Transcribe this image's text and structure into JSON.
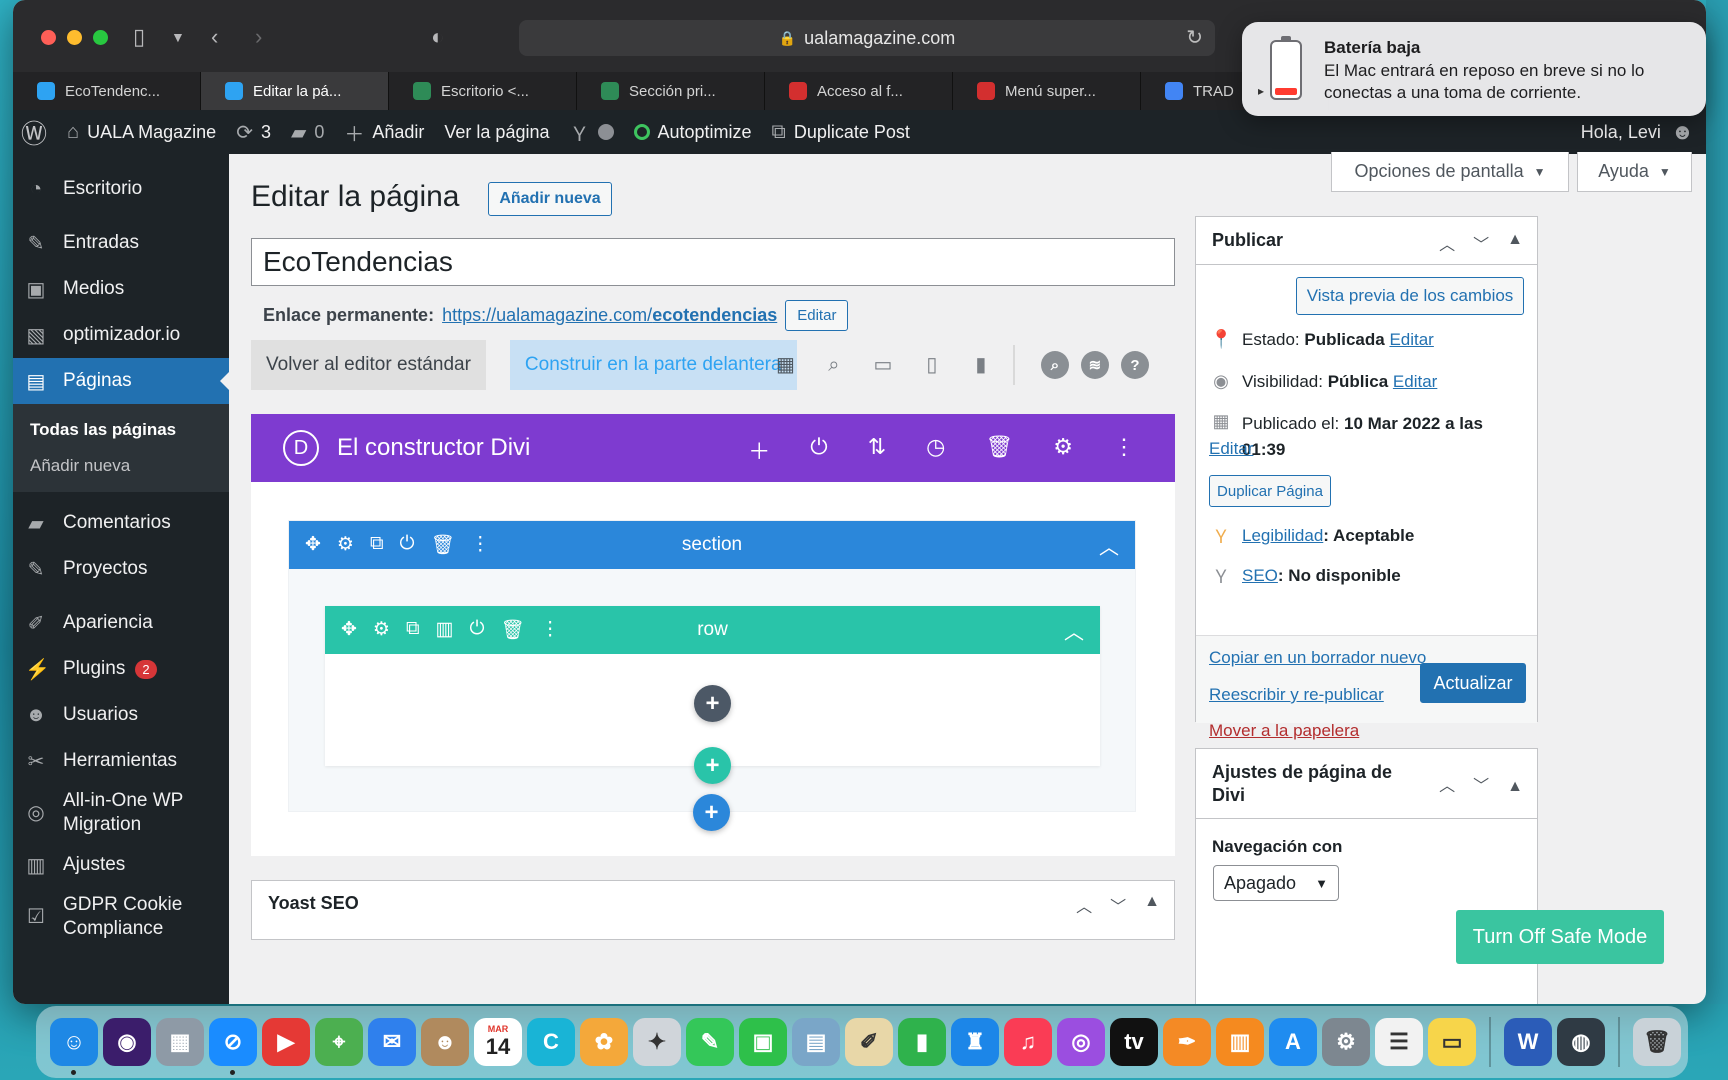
{
  "browser": {
    "url": "ualamagazine.com",
    "tabs": [
      {
        "label": "EcoTendenc...",
        "color": "#2ea3f2",
        "active": false
      },
      {
        "label": "Editar la pá...",
        "color": "#2ea3f2",
        "active": true
      },
      {
        "label": "Escritorio <...",
        "color": "#2e8b57",
        "active": false
      },
      {
        "label": "Sección pri...",
        "color": "#2e8b57",
        "active": false
      },
      {
        "label": "Acceso al f...",
        "color": "#d32f2f",
        "active": false
      },
      {
        "label": "Menú super...",
        "color": "#d32f2f",
        "active": false
      },
      {
        "label": "TRAD",
        "color": "#4285f4",
        "active": false
      }
    ]
  },
  "notification": {
    "title": "Batería baja",
    "body": "El Mac entrará en reposo en breve si no lo conectas a una toma de corriente."
  },
  "adminbar": {
    "site": "UALA Magazine",
    "updates": "3",
    "comments": "0",
    "add": "Añadir",
    "view_page": "Ver la página",
    "autoptimize": "Autoptimize",
    "duplicate_post": "Duplicate Post",
    "greeting": "Hola, Levi"
  },
  "sidebar": {
    "items": [
      {
        "label": "Escritorio",
        "icon": "dashboard-icon"
      },
      {
        "label": "Entradas",
        "icon": "pin-icon"
      },
      {
        "label": "Medios",
        "icon": "media-icon"
      },
      {
        "label": "optimizador.io",
        "icon": "image-icon"
      },
      {
        "label": "Páginas",
        "icon": "pages-icon"
      },
      {
        "label": "Comentarios",
        "icon": "comment-icon"
      },
      {
        "label": "Proyectos",
        "icon": "pin-icon"
      },
      {
        "label": "Apariencia",
        "icon": "brush-icon"
      },
      {
        "label": "Plugins",
        "icon": "plugin-icon",
        "badge": "2"
      },
      {
        "label": "Usuarios",
        "icon": "user-icon"
      },
      {
        "label": "Herramientas",
        "icon": "wrench-icon"
      },
      {
        "label": "All-in-One WP Migration",
        "icon": "migration-icon"
      },
      {
        "label": "Ajustes",
        "icon": "settings-icon"
      },
      {
        "label": "GDPR Cookie Compliance",
        "icon": "check-icon"
      }
    ],
    "submenu": [
      "Todas las páginas",
      "Añadir nueva"
    ]
  },
  "editor": {
    "page_title": "Editar la página",
    "add_new": "Añadir nueva",
    "screen_options": "Opciones de pantalla",
    "help": "Ayuda",
    "post_title": "EcoTendencias",
    "permalink_label": "Enlace permanente:",
    "permalink_base": "https://ualamagazine.com/",
    "permalink_slug": "ecotendencias",
    "permalink_edit": "Editar",
    "back_standard": "Volver al editor estándar",
    "build_front": "Construir en la parte delantera"
  },
  "divi": {
    "title": "El constructor Divi",
    "logo": "D",
    "section_label": "section",
    "row_label": "row"
  },
  "yoast": {
    "title": "Yoast SEO"
  },
  "publish": {
    "title": "Publicar",
    "preview": "Vista previa de los cambios",
    "status_label": "Estado:",
    "status_value": "Publicada",
    "visibility_label": "Visibilidad:",
    "visibility_value": "Pública",
    "published_label": "Publicado el:",
    "published_value": "10 Mar 2022 a las 01:39",
    "edit": "Editar",
    "duplicate": "Duplicar Página",
    "readability_label": "Legibilidad",
    "readability_value": ": Aceptable",
    "seo_label": "SEO",
    "seo_value": ": No disponible",
    "copy_draft": "Copiar en un borrador nuevo",
    "rewrite": "Reescribir y re-publicar",
    "trash": "Mover a la papelera",
    "update": "Actualizar"
  },
  "divi_settings": {
    "title": "Ajustes de página de Divi",
    "nav_label": "Navegación con",
    "nav_value": "Apagado",
    "safe_mode": "Turn Off Safe Mode"
  },
  "dock": {
    "apps": [
      {
        "name": "finder-icon",
        "color": "#1e88e5",
        "glyph": "☺",
        "running": true
      },
      {
        "name": "siri-icon",
        "color": "#3b1d6b",
        "glyph": "◉",
        "running": false
      },
      {
        "name": "launchpad-icon",
        "color": "#8e9aa6",
        "glyph": "▦",
        "running": false
      },
      {
        "name": "safari-icon",
        "color": "#1a8cff",
        "glyph": "⊘",
        "running": true
      },
      {
        "name": "youtube-icon",
        "color": "#e53935",
        "glyph": "▶",
        "running": false
      },
      {
        "name": "maps-icon",
        "color": "#4caf50",
        "glyph": "⌖",
        "running": false
      },
      {
        "name": "mail-icon",
        "color": "#2f80ed",
        "glyph": "✉",
        "running": false
      },
      {
        "name": "contacts-icon",
        "color": "#b08a5e",
        "glyph": "☻",
        "running": false
      },
      {
        "name": "calendar-icon",
        "color": "#ffffff",
        "glyph": "14",
        "running": false
      },
      {
        "name": "canva-icon",
        "color": "#19b4d6",
        "glyph": "C",
        "running": false
      },
      {
        "name": "photos-icon",
        "color": "#f4a83a",
        "glyph": "✿",
        "running": false
      },
      {
        "name": "compass-icon",
        "color": "#d0d5da",
        "glyph": "✦",
        "running": false
      },
      {
        "name": "messages-icon",
        "color": "#34c759",
        "glyph": "✎",
        "running": false
      },
      {
        "name": "facetime-icon",
        "color": "#2ec04a",
        "glyph": "▣",
        "running": false
      },
      {
        "name": "preview-icon",
        "color": "#7aa6c8",
        "glyph": "▤",
        "running": false
      },
      {
        "name": "textedit-icon",
        "color": "#e8d7a8",
        "glyph": "✐",
        "running": false
      },
      {
        "name": "numbers-icon",
        "color": "#2fb24c",
        "glyph": "▮",
        "running": false
      },
      {
        "name": "keynote-icon",
        "color": "#1c86e8",
        "glyph": "♜",
        "running": false
      },
      {
        "name": "music-icon",
        "color": "#fa3c55",
        "glyph": "♫",
        "running": false
      },
      {
        "name": "podcasts-icon",
        "color": "#9b4ee0",
        "glyph": "◎",
        "running": false
      },
      {
        "name": "appletv-icon",
        "color": "#111111",
        "glyph": "tv",
        "running": false
      },
      {
        "name": "pages-icon",
        "color": "#f48a25",
        "glyph": "✒",
        "running": false
      },
      {
        "name": "books-icon",
        "color": "#f58a1f",
        "glyph": "▥",
        "running": false
      },
      {
        "name": "appstore-icon",
        "color": "#1f8cf0",
        "glyph": "A",
        "running": false
      },
      {
        "name": "system-preferences-icon",
        "color": "#7d8790",
        "glyph": "⚙",
        "running": false
      },
      {
        "name": "reminders-icon",
        "color": "#f2f2f2",
        "glyph": "☰",
        "running": false
      },
      {
        "name": "notes-icon",
        "color": "#f7d54a",
        "glyph": "▭",
        "running": false
      },
      {
        "name": "word-icon",
        "color": "#2b5cb8",
        "glyph": "W",
        "running": false
      },
      {
        "name": "quicktime-icon",
        "color": "#2f3a44",
        "glyph": "◍",
        "running": false
      },
      {
        "name": "trash-icon",
        "color": "#c9d2d8",
        "glyph": "🗑",
        "running": false
      }
    ]
  }
}
